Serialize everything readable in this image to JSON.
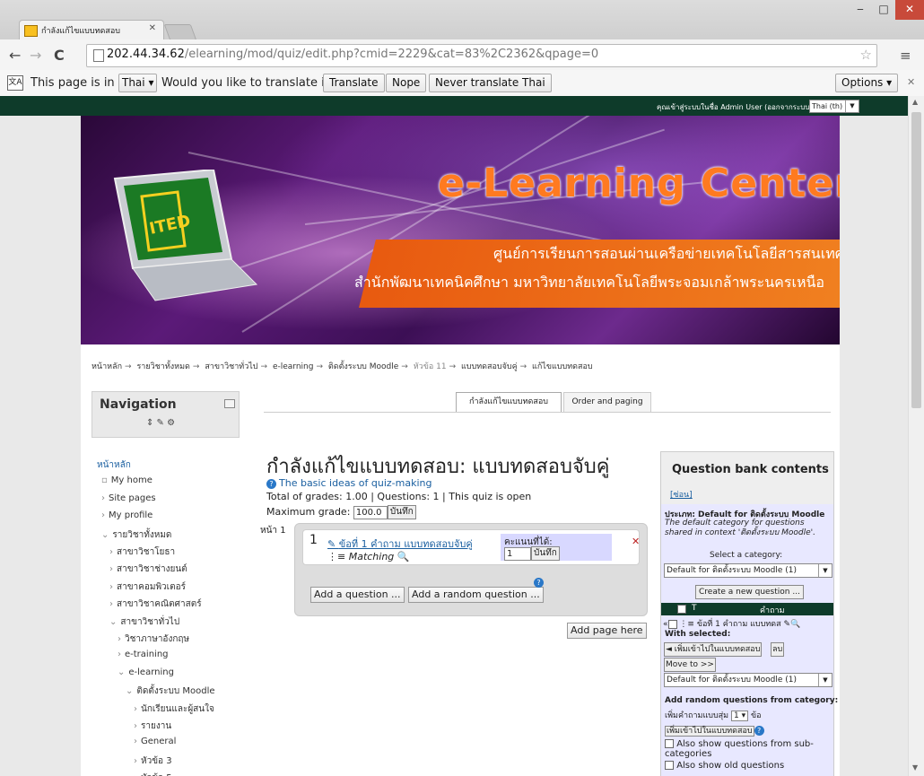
{
  "browser": {
    "tab_title": "กำลังแก้ไขแบบทดสอบ",
    "url_host": "202.44.34.62",
    "url_path": "/elearning/mod/quiz/edit.php?cmid=2229&cat=83%2C2362&qpage=0",
    "window_controls": {
      "minimize": "‒",
      "maximize": "□",
      "close": "✕"
    }
  },
  "translate_bar": {
    "prefix": "This page is in",
    "language": "Thai ▾",
    "question": "Would you like to translate it?",
    "translate": "Translate",
    "nope": "Nope",
    "never": "Never translate Thai",
    "options": "Options ▾"
  },
  "topbar": {
    "login_text": "คุณเข้าสู่ระบบในชื่อ Admin User (ออกจากระบบ)",
    "language_select": "Thai (th)"
  },
  "banner": {
    "title": "e-Learning Center",
    "subtitle1": "ศูนย์การเรียนการสอนผ่านเครือข่ายเทคโนโลยีสารสนเทศ",
    "subtitle2": "สำนักพัฒนาเทคนิคศึกษา มหาวิทยาลัยเทคโนโลยีพระจอมเกล้าพระนครเหนือ",
    "logo_text": "ITED"
  },
  "breadcrumb": [
    "หน้าหลัก",
    "รายวิชาทั้งหมด",
    "สาขาวิชาทั่วไป",
    "e-learning",
    "ติดตั้งระบบ Moodle",
    "หัวข้อ 11",
    "แบบทดสอบจับคู่",
    "แก้ไขแบบทดสอบ"
  ],
  "navigation": {
    "title": "Navigation",
    "items": [
      {
        "label": "หน้าหลัก",
        "prefix": ""
      },
      {
        "label": "My home",
        "prefix": "▫"
      },
      {
        "label": "Site pages",
        "prefix": "›"
      },
      {
        "label": "My profile",
        "prefix": "›"
      },
      {
        "label": "รายวิชาทั้งหมด",
        "prefix": "⌄"
      },
      {
        "label": "สาขาวิชาโยธา",
        "prefix": "›"
      },
      {
        "label": "สาขาวิชาช่างยนต์",
        "prefix": "›"
      },
      {
        "label": "สาขาคอมพิวเตอร์",
        "prefix": "›"
      },
      {
        "label": "สาขาวิชาคณิตศาสตร์",
        "prefix": "›"
      },
      {
        "label": "สาขาวิชาทั่วไป",
        "prefix": "⌄"
      },
      {
        "label": "วิชาภาษาอังกฤษ",
        "prefix": "›"
      },
      {
        "label": "e-training",
        "prefix": "›"
      },
      {
        "label": "e-learning",
        "prefix": "⌄"
      },
      {
        "label": "ติดตั้งระบบ Moodle",
        "prefix": "⌄"
      },
      {
        "label": "นักเรียนและผู้สนใจ",
        "prefix": "›"
      },
      {
        "label": "รายงาน",
        "prefix": "›"
      },
      {
        "label": "General",
        "prefix": "›"
      },
      {
        "label": "หัวข้อ 3",
        "prefix": "›"
      },
      {
        "label": "หัวข้อ 5",
        "prefix": "›"
      },
      {
        "label": "หัวข้อ 6",
        "prefix": "›"
      }
    ]
  },
  "tabs": {
    "editing": "กำลังแก้ไขแบบทดสอบ",
    "order": "Order and paging"
  },
  "main": {
    "title": "กำลังแก้ไขแบบทดสอบ: แบบทดสอบจับคู่",
    "basic_ideas": "The basic ideas of quiz-making",
    "totals": "Total of grades: 1.00 | Questions: 1 | This quiz is open",
    "max_grade_label": "Maximum grade:",
    "max_grade_value": "100.0",
    "save": "บันทึก",
    "page_label": "หน้า 1",
    "question": {
      "number": "1",
      "link": "ข้อที่ 1 คำถาม แบบทดสอบจับคู่",
      "type": "Matching",
      "mark_label": "คะแนนที่ได้:",
      "mark_value": "1",
      "save": "บันทึก"
    },
    "add_question": "Add a question ...",
    "add_random": "Add a random question ...",
    "add_page": "Add page here"
  },
  "question_bank": {
    "title": "Question bank contents",
    "hide": "[ซ่อน]",
    "category_line": "ประเภท: Default for ติดตั้งระบบ Moodle",
    "category_desc": "The default category for questions shared in context 'ติดตั้งระบบ Moodle'.",
    "select_label": "Select a category:",
    "select_value": "Default for ติดตั้งระบบ Moodle (1)",
    "create": "Create a new question ...",
    "col_t": "T",
    "col_question": "คำถาม",
    "row": "ข้อที่ 1 คำถาม แบบทดส",
    "with_selected": "With selected:",
    "add_to_quiz": "◄ เพิ่มเข้าไปในแบบทดสอบ",
    "delete": "ลบ",
    "move_to": "Move to >>",
    "move_select": "Default for ติดตั้งระบบ Moodle (1)",
    "random_label": "Add random questions from category:",
    "random_add": "เพิ่มคำถามแบบสุ่ม",
    "random_count": "1",
    "random_unit": "ข้อ",
    "random_btn": "เพิ่มเข้าไปในแบบทดสอบ",
    "also_sub": "Also show questions from sub-categories",
    "also_old": "Also show old questions"
  }
}
